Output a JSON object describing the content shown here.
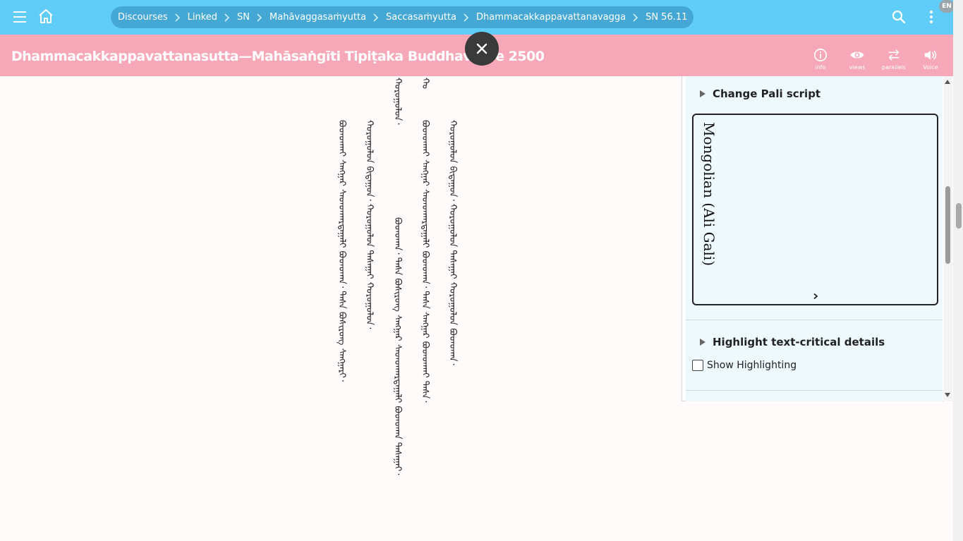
{
  "header": {
    "breadcrumbs": [
      "Discourses",
      "Linked",
      "SN",
      "Mahāvaggasaṁyutta",
      "Saccasaṁyutta",
      "Dhammacakkappavattanavagga",
      "SN 56.11"
    ],
    "language_badge": "EN"
  },
  "titlebar": {
    "title": "Dhammacakkappavattanasutta—Mahāsaṅgīti Tipiṭaka Buddhavasse 2500",
    "tools": [
      {
        "label": "info",
        "icon": "info-icon"
      },
      {
        "label": "views",
        "icon": "eye-icon"
      },
      {
        "label": "parallels",
        "icon": "parallels-icon"
      },
      {
        "label": "Voice",
        "icon": "speaker-icon"
      }
    ]
  },
  "text_columns": [
    "ᠪᠤᠳᠳᠬᠠᠢ ᠰᠠᠩᠭᠠᠷ ᠰᠠᠳᠳᠬᠠᠷᠲᠠᠭᠠᠯᠢ ᠪᠤᠳᠳᠬᠠ᠂ ᠳᠠᠰᠠ ᠪᠣᠰᠢᠷᠤᠩ ᠰᠠᠩᠭᠠᠷᠢ᠂",
    "ᠬᠤᠷᠤᠭᠤᠯᠤᠨ ᠪᠢᠳᠠᠭᠤᠨ᠂ ᠬᠤᠷᠤᠭᠤᠯᠤᠨ ᠳᠠᠰᠠᠭᠠᠢ ᠬᠤᠷᠤᠭᠤᠯᠤᠨ᠂",
    "ᠬᠤᠷᠤᠭᠤᠯᠤᠨ᠂",
    "ᠪᠤᠳᠳᠬᠠ᠂ ᠳᠠᠰᠠ ᠪᠣᠰᠢᠷᠤᠩ ᠰᠠᠩᠭᠠᠷ ᠰᠠᠳᠳᠬᠠᠷᠲᠠᠭᠠᠯᠢ ᠪᠤᠳᠳᠬᠠ ᠳᠠᠰᠠᠭᠠᠢ᠂",
    "ᠪᠤᠳᠳᠬᠠᠢ ᠰᠠᠩᠭᠠᠷ ᠰᠠᠳᠳᠬᠠᠷᠲᠠᠭᠠᠯᠢ ᠪᠤᠳᠳᠬᠠ᠂ ᠳᠠᠰᠠ ᠰᠠᠩᠭᠠᠷ ᠪᠤᠳᠳᠬᠠᠢ ᠳᠠᠰᠠ᠂",
    "ᠬᠤᠷᠤᠭᠤᠯᠤᠨ ᠪᠢᠳᠠᠭᠤᠨ᠂ ᠬᠤᠷᠤᠭᠤᠯᠤᠨ ᠳᠠᠰᠠᠭᠠᠢ ᠬᠤᠷᠤᠭᠤᠯᠤᠨ ᠪᠤᠳᠳᠬᠠ᠂",
    "ᠬᠤ"
  ],
  "settings_panel": {
    "script_section_label": "Change Pali script",
    "selected_script": "Mongolian (Ali Gali)",
    "highlight_section_label": "Highlight text-critical details",
    "show_highlighting_label": "Show Highlighting",
    "show_highlighting_checked": false
  },
  "colors": {
    "topbar": "#60cdf8",
    "breadcrumb_bg": "#45a8d4",
    "titlebar": "#f6a8b8",
    "panel_bg": "#eef9fe",
    "close_fab": "#3a3a3a"
  }
}
